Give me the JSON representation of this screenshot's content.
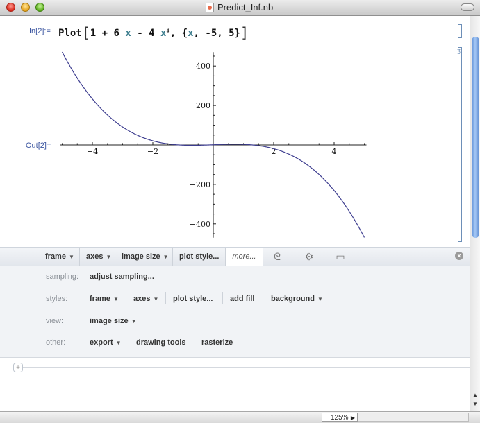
{
  "window": {
    "title": "Predict_Inf.nb"
  },
  "cell": {
    "in_label": "In[2]:=",
    "out_label": "Out[2]=",
    "input": {
      "head": "Plot",
      "expr_a": "1 + 6 ",
      "var_x": "x",
      "expr_b": " - 4 ",
      "var_x2": "x",
      "power": "3",
      "expr_c": ", {",
      "var_x3": "x",
      "expr_d": ", -5, 5}"
    }
  },
  "chart_data": {
    "type": "line",
    "function": "1 + 6 x - 4 x^3",
    "x_range": [
      -5,
      5
    ],
    "xlim": [
      -5,
      5
    ],
    "ylim": [
      -470,
      470
    ],
    "x_ticks": [
      "-4",
      "-2",
      "2",
      "4"
    ],
    "y_ticks": [
      "400",
      "200",
      "-200",
      "-400"
    ],
    "x_tick_values": [
      -4,
      -2,
      2,
      4
    ],
    "y_tick_values": [
      400,
      200,
      -200,
      -400
    ],
    "line_color": "#3d3d8f",
    "grid": false
  },
  "suggestion_bar": {
    "frame": "frame",
    "axes": "axes",
    "image_size": "image size",
    "plot_style": "plot style...",
    "more": "more...",
    "icons": [
      "spiral-icon",
      "chip-icon",
      "comment-icon"
    ]
  },
  "panel": {
    "sampling_label": "sampling:",
    "adjust_sampling": "adjust sampling...",
    "styles_label": "styles:",
    "frame": "frame",
    "axes": "axes",
    "plot_style": "plot style...",
    "add_fill": "add fill",
    "background": "background",
    "view_label": "view:",
    "image_size": "image size",
    "other_label": "other:",
    "export": "export",
    "drawing_tools": "drawing tools",
    "rasterize": "rasterize"
  },
  "status": {
    "zoom": "125%"
  }
}
